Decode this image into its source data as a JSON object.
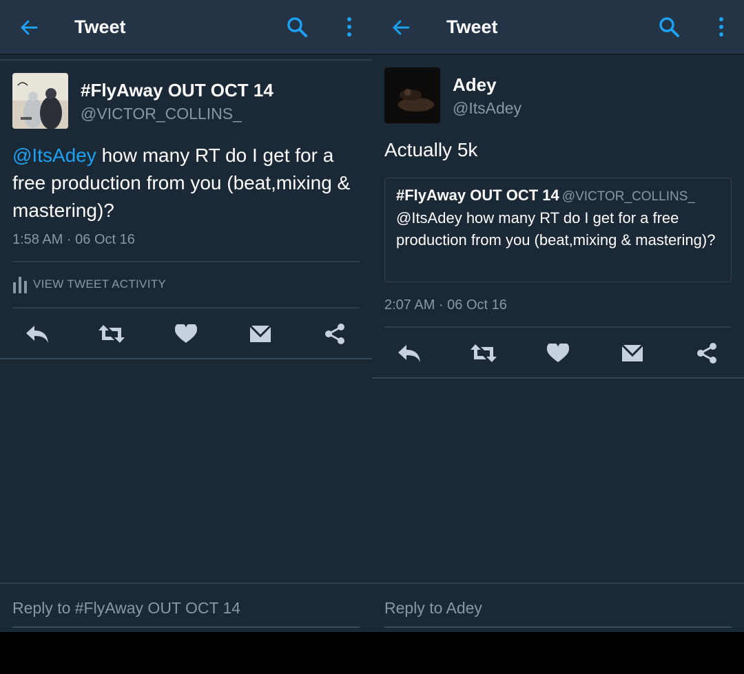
{
  "colors": {
    "background": "#1b2836",
    "toolbar": "#243447",
    "accent": "#1da1f2",
    "muted": "#8899a6",
    "icon": "#c5d1dc"
  },
  "left": {
    "toolbar": {
      "title": "Tweet",
      "back_icon": "arrow-left-icon",
      "search_icon": "search-icon",
      "more_icon": "more-vertical-icon"
    },
    "tweet": {
      "name": "#FlyAway OUT OCT 14",
      "handle": "@VICTOR_COLLINS_",
      "avatar": "album-cover-avatar",
      "mention": "@ItsAdey",
      "text": " how many RT do I get for a free production from you (beat,mixing & mastering)?",
      "timestamp": "1:58 AM · 06 Oct 16",
      "activity_label": "VIEW TWEET ACTIVITY"
    },
    "actions": [
      "reply-icon",
      "retweet-icon",
      "heart-icon",
      "message-icon",
      "share-icon"
    ],
    "reply_placeholder": "Reply to #FlyAway OUT OCT 14"
  },
  "right": {
    "toolbar": {
      "title": "Tweet",
      "back_icon": "arrow-left-icon",
      "search_icon": "search-icon",
      "more_icon": "more-vertical-icon"
    },
    "tweet": {
      "name": "Adey",
      "handle": "@ItsAdey",
      "avatar": "profile-photo-avatar",
      "text": "Actually 5k",
      "timestamp": "2:07 AM · 06 Oct 16"
    },
    "quoted": {
      "name": "#FlyAway OUT OCT 14",
      "handle": "@VICTOR_COLLINS_",
      "text": "@ItsAdey how many RT do I get for a free production from you (beat,mixing & mastering)?"
    },
    "actions": [
      "reply-icon",
      "retweet-icon",
      "heart-icon",
      "message-icon",
      "share-icon"
    ],
    "reply_placeholder": "Reply to Adey"
  }
}
